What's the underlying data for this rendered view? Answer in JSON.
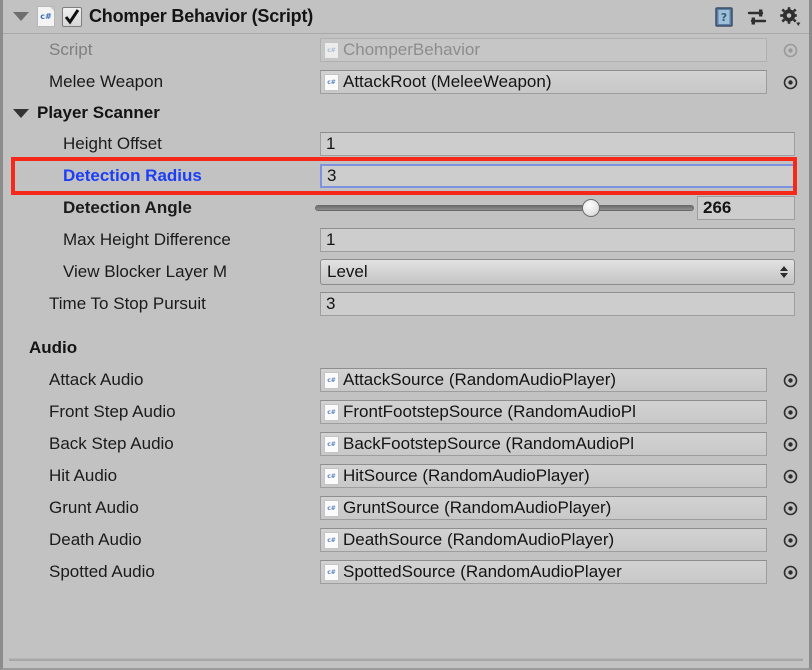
{
  "component": {
    "title": "Chomper Behavior (Script)",
    "enabled": true,
    "script_icon": "csharp-script-icon",
    "foldout_expanded": true,
    "header_icons": [
      {
        "name": "help-icon",
        "label": "?"
      },
      {
        "name": "preset-icon",
        "label": ""
      },
      {
        "name": "settings-gear-icon",
        "label": ""
      }
    ]
  },
  "fields": {
    "script": {
      "label": "Script",
      "value": "ChomperBehavior",
      "disabled": true,
      "icon": "csharp-script-icon"
    },
    "melee_weapon": {
      "label": "Melee Weapon",
      "value": "AttackRoot (MeleeWeapon)",
      "icon": "csharp-script-icon"
    }
  },
  "player_scanner": {
    "label": "Player Scanner",
    "expanded": true,
    "height_offset": {
      "label": "Height Offset",
      "value": "1"
    },
    "detection_radius": {
      "label": "Detection Radius",
      "value": "3",
      "highlighted": true,
      "label_color": "#1c3ef5"
    },
    "detection_angle": {
      "label": "Detection Angle",
      "value": "266",
      "slider_percent": 73
    },
    "max_height_difference": {
      "label": "Max Height Difference",
      "value": "1"
    },
    "view_blocker_layer_mask": {
      "label": "View Blocker Layer M",
      "value": "Level"
    }
  },
  "time_to_stop_pursuit": {
    "label": "Time To Stop Pursuit",
    "value": "3"
  },
  "audio": {
    "heading": "Audio",
    "items": [
      {
        "label": "Attack Audio",
        "value": "AttackSource (RandomAudioPlayer)"
      },
      {
        "label": "Front Step Audio",
        "value": "FrontFootstepSource (RandomAudioPl"
      },
      {
        "label": "Back Step Audio",
        "value": "BackFootstepSource (RandomAudioPl"
      },
      {
        "label": "Hit Audio",
        "value": "HitSource (RandomAudioPlayer)"
      },
      {
        "label": "Grunt Audio",
        "value": "GruntSource (RandomAudioPlayer)"
      },
      {
        "label": "Death Audio",
        "value": "DeathSource (RandomAudioPlayer)"
      },
      {
        "label": "Spotted Audio",
        "value": "SpottedSource (RandomAudioPlayer"
      }
    ]
  },
  "colors": {
    "background": "#c2c2c2",
    "field_background": "#cdcdcd",
    "highlight_red": "#f52819",
    "selected_label_blue": "#1c3ef5",
    "selection_border": "#7f92e0"
  }
}
